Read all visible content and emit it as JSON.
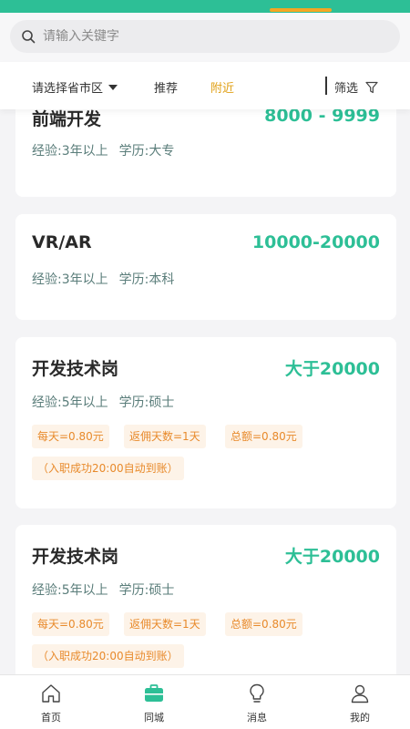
{
  "search": {
    "placeholder": "请输入关键字"
  },
  "filter": {
    "region_label": "请选择省市区",
    "tab_recommend": "推荐",
    "tab_nearby": "附近",
    "filter_label": "筛选"
  },
  "colors": {
    "brand_green": "#2dbf96",
    "accent_orange": "#f5a623",
    "tag_text": "#e88a2b"
  },
  "jobs": [
    {
      "title": "前端开发",
      "salary": "8000 - 9999",
      "experience": "经验:3年以上",
      "education": "学历:大专"
    },
    {
      "title": "VR/AR",
      "salary": "10000-20000",
      "experience": "经验:3年以上",
      "education": "学历:本科"
    },
    {
      "title": "开发技术岗",
      "salary": "大于20000",
      "experience": "经验:5年以上",
      "education": "学历:硕士",
      "tags": [
        "每天=0.80元",
        "返佣天数=1天",
        "总额=0.80元",
        "（入职成功20:00自动到账）"
      ]
    },
    {
      "title": "开发技术岗",
      "salary": "大于20000",
      "experience": "经验:5年以上",
      "education": "学历:硕士",
      "tags": [
        "每天=0.80元",
        "返佣天数=1天",
        "总额=0.80元",
        "（入职成功20:00自动到账）"
      ]
    }
  ],
  "tabbar": [
    {
      "label": "首页",
      "icon": "home-icon"
    },
    {
      "label": "同城",
      "icon": "briefcase-icon",
      "active": true
    },
    {
      "label": "消息",
      "icon": "lightbulb-icon"
    },
    {
      "label": "我的",
      "icon": "person-icon"
    }
  ]
}
